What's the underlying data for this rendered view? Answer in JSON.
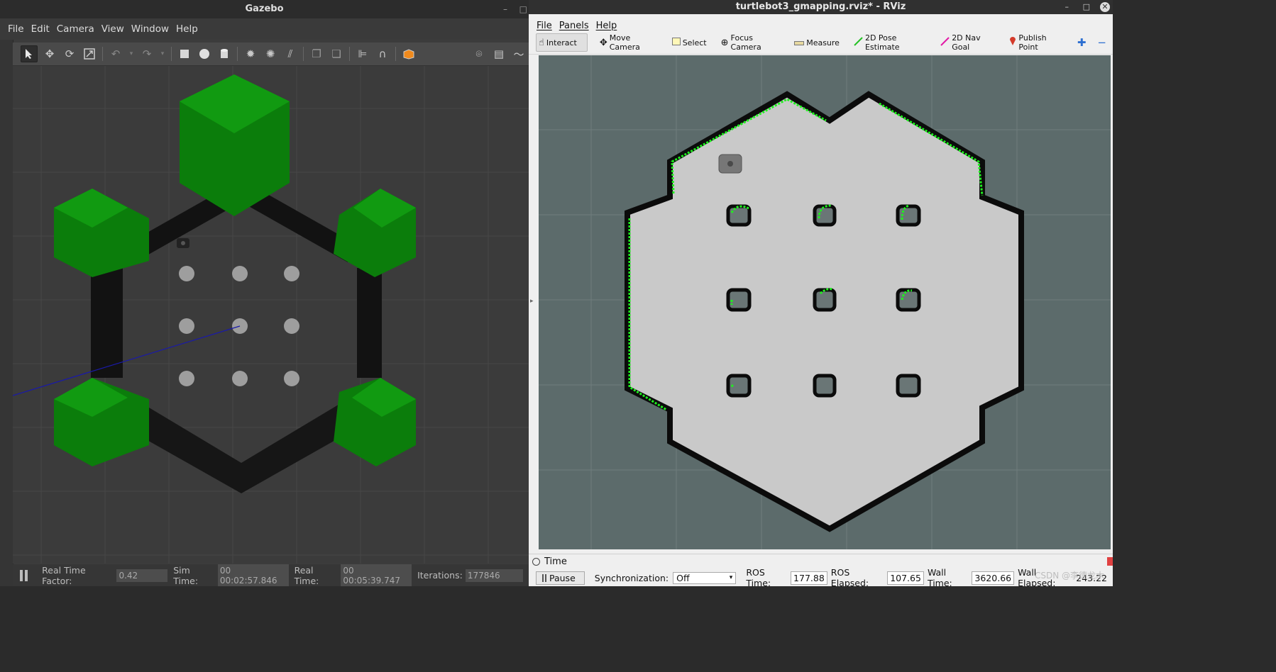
{
  "gazebo": {
    "window_title": "Gazebo",
    "window_buttons": [
      "–",
      "□"
    ],
    "menu": [
      "File",
      "Edit",
      "Camera",
      "View",
      "Window",
      "Help"
    ],
    "toolbar_icons": [
      "select-arrow",
      "translate",
      "rotate",
      "scale",
      "undo",
      "undo-dropdown",
      "redo",
      "redo-dropdown",
      "box",
      "sphere",
      "cylinder",
      "point-light",
      "spot-light",
      "directional-light",
      "copy",
      "paste",
      "align",
      "snap",
      "change-view",
      "screenshot",
      "log",
      "plot"
    ],
    "status": {
      "real_time_factor_label": "Real Time Factor:",
      "real_time_factor": "0.42",
      "sim_time_label": "Sim Time:",
      "sim_time": "00 00:02:57.846",
      "real_time_label": "Real Time:",
      "real_time": "00 00:05:39.747",
      "iterations_label": "Iterations:",
      "iterations": "177846"
    },
    "scene_colors": {
      "ground": "#3b3b3b",
      "grid": "#4a4a4a",
      "wall": "#111111",
      "obstacle": "#0e7a0e",
      "pillar": "#9a9a9a"
    }
  },
  "rviz": {
    "window_title": "turtlebot3_gmapping.rviz* - RViz",
    "window_buttons": [
      "–",
      "□",
      "✕"
    ],
    "menu": [
      "File",
      "Panels",
      "Help"
    ],
    "tools": [
      {
        "label": "Interact",
        "icon": "hand-icon"
      },
      {
        "label": "Move Camera",
        "icon": "move-camera-icon"
      },
      {
        "label": "Select",
        "icon": "select-icon"
      },
      {
        "label": "Focus Camera",
        "icon": "focus-camera-icon"
      },
      {
        "label": "Measure",
        "icon": "measure-icon"
      },
      {
        "label": "2D Pose Estimate",
        "icon": "pose-estimate-icon"
      },
      {
        "label": "2D Nav Goal",
        "icon": "nav-goal-icon"
      },
      {
        "label": "Publish Point",
        "icon": "publish-point-icon"
      }
    ],
    "time_panel": {
      "title": "Time",
      "pause_label": "Pause",
      "sync_label": "Synchronization:",
      "sync_value": "Off",
      "ros_time_label": "ROS Time:",
      "ros_time": "177.88",
      "ros_elapsed_label": "ROS Elapsed:",
      "ros_elapsed": "107.65",
      "wall_time_label": "Wall Time:",
      "wall_time": "3620.66",
      "wall_elapsed_label": "Wall Elapsed:",
      "wall_elapsed": "243.22"
    },
    "watermark": "CSDN @李德龙木",
    "map_colors": {
      "unknown": "#5c6b6b",
      "free": "#c8c8c8",
      "occupied": "#0a0a0a",
      "laser": "#22ee22"
    }
  }
}
